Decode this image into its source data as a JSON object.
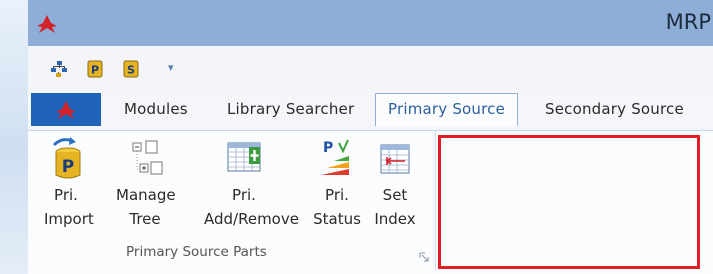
{
  "window": {
    "title": "MRP"
  },
  "quick_access": {
    "buttons": [
      {
        "icon": "org-chart-icon"
      },
      {
        "icon": "p-badge-icon",
        "text": "P"
      },
      {
        "icon": "s-badge-icon",
        "text": "S"
      }
    ],
    "customize_glyph": "▾"
  },
  "tabs": {
    "file_icon": "app-logo-icon",
    "items": [
      {
        "label": "Modules",
        "active": false
      },
      {
        "label": "Library Searcher",
        "active": false
      },
      {
        "label": "Primary Source",
        "active": true
      },
      {
        "label": "Secondary Source",
        "active": false
      }
    ]
  },
  "ribbon": {
    "group": {
      "label": "Primary Source Parts",
      "buttons": [
        {
          "line1": "Pri.",
          "line2": "Import",
          "icon": "database-import-icon"
        },
        {
          "line1": "Manage",
          "line2": "Tree",
          "icon": "tree-icon"
        },
        {
          "line1": "Pri.",
          "line2": "Add/Remove",
          "icon": "grid-add-icon"
        },
        {
          "line1": "Pri.",
          "line2": "Status",
          "icon": "status-bars-icon"
        },
        {
          "line1": "Set",
          "line2": "Index",
          "icon": "index-table-icon"
        }
      ]
    },
    "highlight_color": "#e01c24"
  }
}
